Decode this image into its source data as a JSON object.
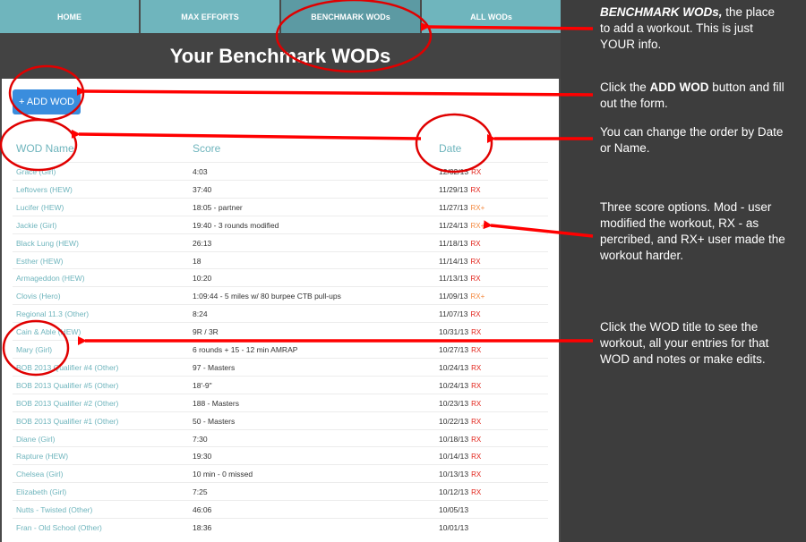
{
  "nav": [
    "HOME",
    "MAX EFFORTS",
    "BENCHMARK WODs",
    "ALL WODs"
  ],
  "page_title": "Your Benchmark WODs",
  "add_button": "+ ADD WOD",
  "columns": {
    "name": "WOD Name",
    "score": "Score",
    "date": "Date"
  },
  "colors": {
    "rx": "#e2231a",
    "rx_plus": "#f48a40",
    "link": "#6fb5bd",
    "annotation": "#ff0000"
  },
  "rows": [
    {
      "name": "Grace (Girl)",
      "score": "4:03",
      "date": "12/02/13",
      "badge": "RX"
    },
    {
      "name": "Leftovers (HEW)",
      "score": "37:40",
      "date": "11/29/13",
      "badge": "RX"
    },
    {
      "name": "Lucifer (HEW)",
      "score": "18:05 - partner",
      "date": "11/27/13",
      "badge": "RX+"
    },
    {
      "name": "Jackie (Girl)",
      "score": "19:40 - 3 rounds modified",
      "date": "11/24/13",
      "badge": "RX+"
    },
    {
      "name": "Black Lung (HEW)",
      "score": "26:13",
      "date": "11/18/13",
      "badge": "RX"
    },
    {
      "name": "Esther (HEW)",
      "score": "18",
      "date": "11/14/13",
      "badge": "RX"
    },
    {
      "name": "Armageddon (HEW)",
      "score": "10:20",
      "date": "11/13/13",
      "badge": "RX"
    },
    {
      "name": "Clovis (Hero)",
      "score": "1:09:44 - 5 miles w/ 80 burpee CTB pull-ups",
      "date": "11/09/13",
      "badge": "RX+"
    },
    {
      "name": "Regional 11.3 (Other)",
      "score": "8:24",
      "date": "11/07/13",
      "badge": "RX"
    },
    {
      "name": "Cain & Able (HEW)",
      "score": "9R / 3R",
      "date": "10/31/13",
      "badge": "RX"
    },
    {
      "name": "Mary (Girl)",
      "score": "6 rounds + 15 - 12 min AMRAP",
      "date": "10/27/13",
      "badge": "RX"
    },
    {
      "name": "BOB 2013 Qualifier #4 (Other)",
      "score": "97 - Masters",
      "date": "10/24/13",
      "badge": "RX"
    },
    {
      "name": "BOB 2013 Qualifier #5 (Other)",
      "score": "18'-9\"",
      "date": "10/24/13",
      "badge": "RX"
    },
    {
      "name": "BOB 2013 Qualifier #2 (Other)",
      "score": "188 - Masters",
      "date": "10/23/13",
      "badge": "RX"
    },
    {
      "name": "BOB 2013 Qualifier #1 (Other)",
      "score": "50 - Masters",
      "date": "10/22/13",
      "badge": "RX"
    },
    {
      "name": "Diane (Girl)",
      "score": "7:30",
      "date": "10/18/13",
      "badge": "RX"
    },
    {
      "name": "Rapture (HEW)",
      "score": "19:30",
      "date": "10/14/13",
      "badge": "RX"
    },
    {
      "name": "Chelsea (Girl)",
      "score": "10 min - 0 missed",
      "date": "10/13/13",
      "badge": "RX"
    },
    {
      "name": "Elizabeth (Girl)",
      "score": "7:25",
      "date": "10/12/13",
      "badge": "RX"
    },
    {
      "name": "Nutts - Twisted (Other)",
      "score": "46:06",
      "date": "10/05/13",
      "badge": ""
    },
    {
      "name": "Fran - Old School (Other)",
      "score": "18:36",
      "date": "10/01/13",
      "badge": ""
    }
  ],
  "annotations": {
    "benchmark_bold": "BENCHMARK WODs,",
    "benchmark_rest": " the place to add a workout. This is just YOUR info.",
    "add_pre": "Click the ",
    "add_bold": "ADD WOD",
    "add_post": " button and fill out the form.",
    "order": "You can change the order by Date or Name.",
    "scores": "Three score options. Mod - user modified the workout, RX - as percribed, and RX+ user made the workout harder.",
    "title": "Click the WOD title to see the workout, all your entries for that WOD and notes or make edits."
  }
}
